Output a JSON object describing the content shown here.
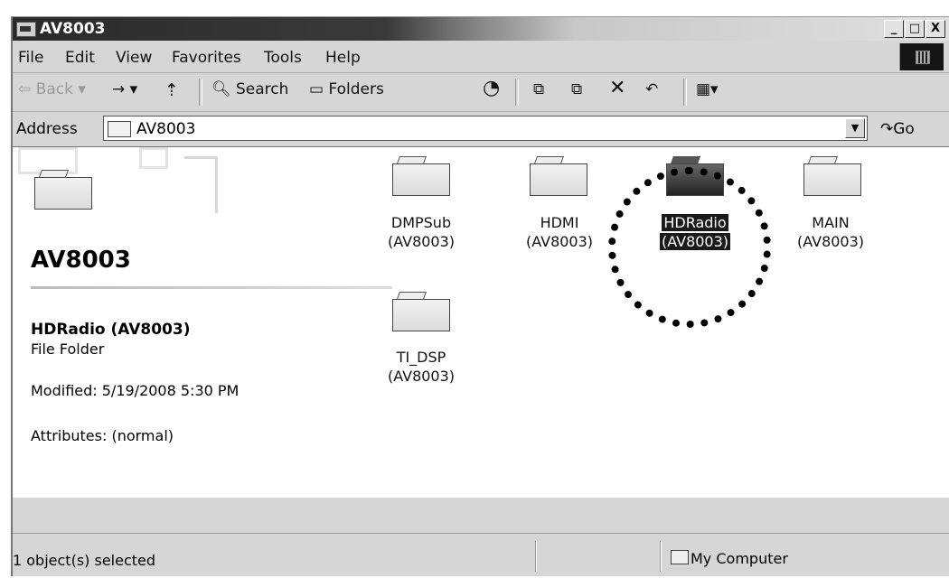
{
  "window": {
    "title": "AV8003",
    "minimize": "_",
    "maximize": "□",
    "close": "X"
  },
  "menu": [
    "File",
    "Edit",
    "View",
    "Favorites",
    "Tools",
    "Help"
  ],
  "menu_underline": [
    "F",
    "E",
    "V",
    "a",
    "T",
    "H"
  ],
  "toolbar": {
    "back": "Back",
    "forward": "→",
    "search": "Search",
    "folders": "Folders"
  },
  "address": {
    "label": "Address",
    "value": "AV8003",
    "go": "Go"
  },
  "sidebar": {
    "title": "AV8003",
    "selected_name": "HDRadio (AV8003)",
    "selected_type": "File Folder",
    "modified": "Modified: 5/19/2008 5:30 PM",
    "attributes": "Attributes: (normal)"
  },
  "folders": [
    {
      "name": "DMPSub",
      "sub": "(AV8003)",
      "selected": false
    },
    {
      "name": "HDMI",
      "sub": "(AV8003)",
      "selected": false
    },
    {
      "name": "HDRadio",
      "sub": "(AV8003)",
      "selected": true
    },
    {
      "name": "MAIN",
      "sub": "(AV8003)",
      "selected": false
    },
    {
      "name": "TI_DSP",
      "sub": "(AV8003)",
      "selected": false
    }
  ],
  "status": {
    "selection": "1 object(s) selected",
    "location": "My Computer"
  }
}
